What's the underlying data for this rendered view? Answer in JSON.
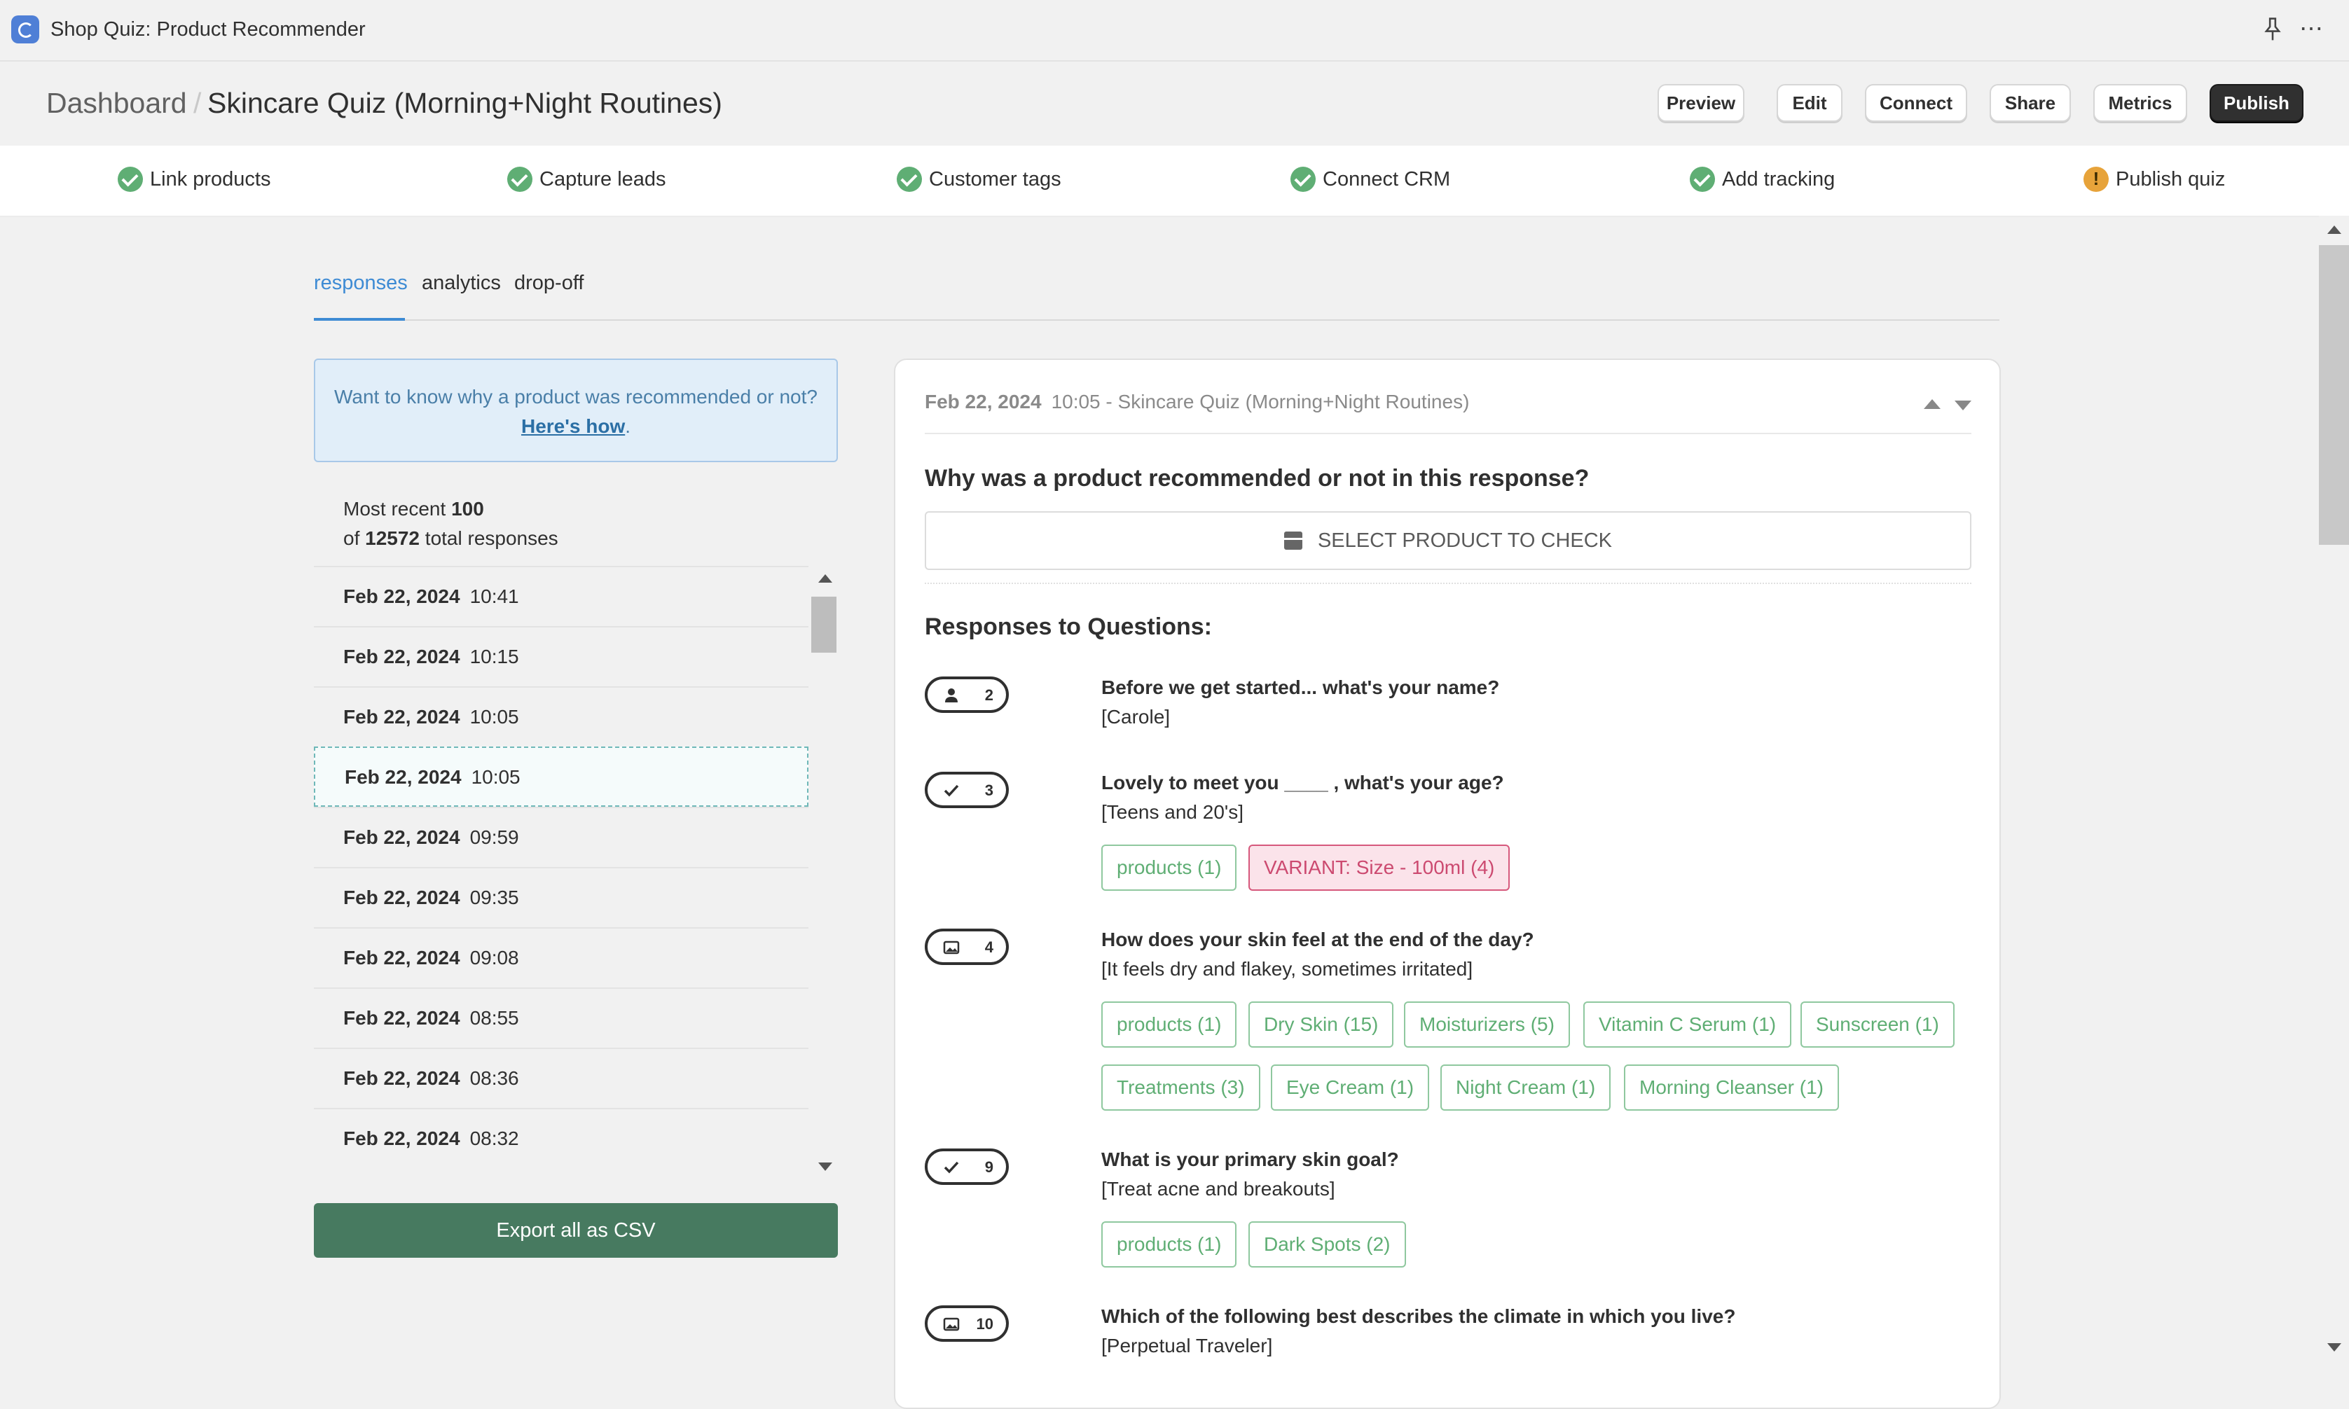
{
  "app": {
    "title": "Shop Quiz: Product Recommender"
  },
  "header": {
    "breadcrumb": "Dashboard",
    "title": "Skincare Quiz (Morning+Night Routines)",
    "buttons": {
      "preview": "Preview",
      "edit": "Edit",
      "connect": "Connect",
      "share": "Share",
      "metrics": "Metrics",
      "publish": "Publish"
    }
  },
  "steps": [
    {
      "label": "Link products",
      "status": "done"
    },
    {
      "label": "Capture leads",
      "status": "done"
    },
    {
      "label": "Customer tags",
      "status": "done"
    },
    {
      "label": "Connect CRM",
      "status": "done"
    },
    {
      "label": "Add tracking",
      "status": "done"
    },
    {
      "label": "Publish quiz",
      "status": "warning"
    }
  ],
  "tabs": [
    {
      "label": "responses",
      "active": true
    },
    {
      "label": "analytics"
    },
    {
      "label": "drop-off"
    }
  ],
  "info": {
    "text": "Want to know why a product was recommended or not?",
    "link": "Here's how",
    "suffix": "."
  },
  "summary": {
    "prefix": "Most recent",
    "recent": "100",
    "of": "of",
    "total": "12572",
    "suffix": "total responses"
  },
  "responses": [
    {
      "date": "Feb 22, 2024",
      "time": "10:41"
    },
    {
      "date": "Feb 22, 2024",
      "time": "10:15"
    },
    {
      "date": "Feb 22, 2024",
      "time": "10:05"
    },
    {
      "date": "Feb 22, 2024",
      "time": "10:05",
      "selected": true
    },
    {
      "date": "Feb 22, 2024",
      "time": "09:59"
    },
    {
      "date": "Feb 22, 2024",
      "time": "09:35"
    },
    {
      "date": "Feb 22, 2024",
      "time": "09:08"
    },
    {
      "date": "Feb 22, 2024",
      "time": "08:55"
    },
    {
      "date": "Feb 22, 2024",
      "time": "08:36"
    },
    {
      "date": "Feb 22, 2024",
      "time": "08:32"
    }
  ],
  "export_label": "Export all as CSV",
  "detail": {
    "date": "Feb 22, 2024",
    "subtitle": "10:05 - Skincare Quiz (Morning+Night Routines)",
    "why_title": "Why was a product recommended or not in this response?",
    "select_label": "SELECT PRODUCT TO CHECK",
    "responses_title": "Responses to Questions:",
    "questions": [
      {
        "num": "2",
        "icon": "person-icon",
        "question": "Before we get started... what's your name?",
        "answer": "[Carole]",
        "tags": []
      },
      {
        "num": "3",
        "icon": "check-icon",
        "question": "Lovely to meet you ____ , what's your age?",
        "answer": "[Teens and 20's]",
        "tags": [
          {
            "label": "products (1)"
          },
          {
            "label": "VARIANT: Size - 100ml (4)",
            "variant": true
          }
        ]
      },
      {
        "num": "4",
        "icon": "image-icon",
        "question": "How does your skin feel at the end of the day?",
        "answer": "[It feels dry and flakey, sometimes irritated]",
        "tags": [
          {
            "label": "products (1)"
          },
          {
            "label": "Dry Skin (15)"
          },
          {
            "label": "Moisturizers (5)"
          },
          {
            "label": "Vitamin C Serum (1)"
          },
          {
            "label": "Sunscreen (1)"
          },
          {
            "label": "Treatments (3)"
          },
          {
            "label": "Eye Cream (1)"
          },
          {
            "label": "Night Cream (1)"
          },
          {
            "label": "Morning Cleanser (1)"
          }
        ]
      },
      {
        "num": "9",
        "icon": "check-icon",
        "question": "What is your primary skin goal?",
        "answer": "[Treat acne and breakouts]",
        "tags": [
          {
            "label": "products (1)"
          },
          {
            "label": "Dark Spots (2)"
          }
        ]
      },
      {
        "num": "10",
        "icon": "image-icon",
        "question": "Which of the following best describes the climate in which you live?",
        "answer": "[Perpetual Traveler]",
        "tags": []
      }
    ]
  },
  "colors": {
    "accent": "#3e8bd4",
    "success": "#5fae74",
    "warning": "#e7a33a",
    "export": "#477a60",
    "variant": "#cc4a70"
  }
}
